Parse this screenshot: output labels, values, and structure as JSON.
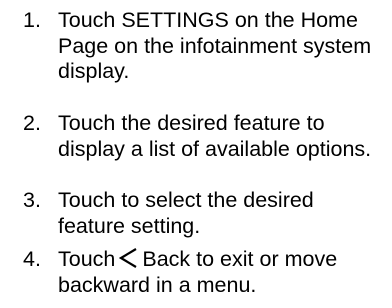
{
  "steps": [
    {
      "number": "1.",
      "text": "Touch SETTINGS on the Home Page on the infotainment system display."
    },
    {
      "number": "2.",
      "text": "Touch the desired feature to display a list of available options."
    },
    {
      "number": "3.",
      "text": "Touch to select the desired feature setting."
    },
    {
      "number": "4.",
      "text_before": "Touch",
      "icon": "back-chevron-icon",
      "text_after": "Back to exit or move backward in a menu."
    }
  ]
}
